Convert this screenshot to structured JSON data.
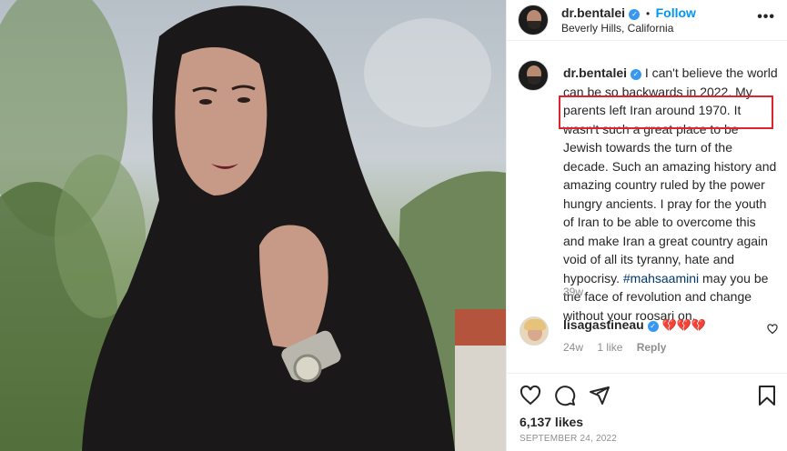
{
  "post": {
    "author": {
      "username": "dr.bentalei",
      "follow_label": "Follow",
      "separator": "•",
      "location": "Beverly Hills, California",
      "verified_glyph": "✓"
    },
    "caption": {
      "username": "dr.bentalei",
      "text_part1": "I can't believe the world can be so backwards in 2022. My parents left Iran around 1970. It wasn't such a great place to be Jewish towards the turn of the decade. Such an amazing history and amazing country ruled by the power hungry ancients. I pray for the youth of Iran to be able to overcome this and make Iran a great country again void of all its tyranny, hate and hypocrisy.",
      "hashtag": "#mahsaamini",
      "text_part2": "may you be the face of revolution and change without your roosari on."
    },
    "caption_age": "39w",
    "comment": {
      "username": "lisagastineau",
      "emojis": "💔💔💔",
      "age": "24w",
      "likes": "1 like",
      "reply_label": "Reply"
    },
    "likes_label": "6,137 likes",
    "date": "SEPTEMBER 24, 2022"
  },
  "icons": {
    "more": "more-options-icon",
    "heart": "heart-icon",
    "comment": "comment-icon",
    "share": "share-icon",
    "save": "bookmark-icon"
  },
  "colors": {
    "accent": "#0095f6",
    "verified": "#3897f0",
    "highlight": "#e0242f",
    "broken_heart": "#e0245e"
  }
}
